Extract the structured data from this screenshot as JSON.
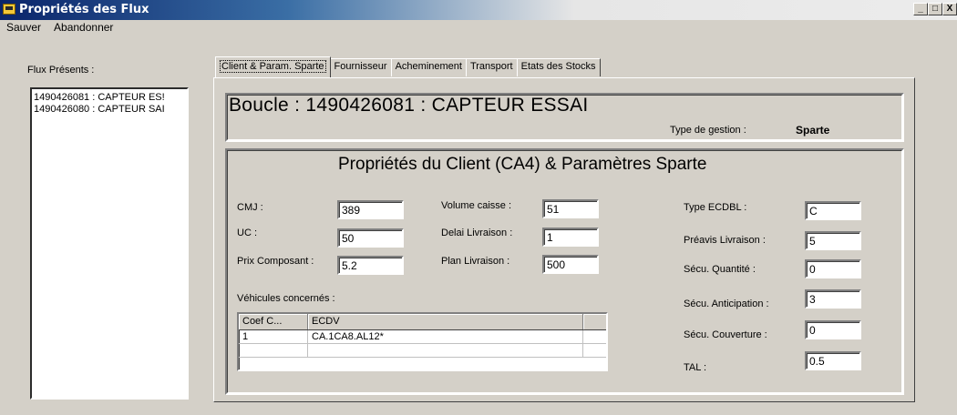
{
  "window": {
    "title": "Propriétés des Flux",
    "buttons": [
      "_",
      "□",
      "X"
    ]
  },
  "menu": {
    "items": [
      {
        "label": "Sauver"
      },
      {
        "label": "Abandonner"
      }
    ]
  },
  "flux": {
    "label": "Flux Présents :",
    "items": [
      "1490426081 : CAPTEUR ES!",
      "1490426080 : CAPTEUR SAI"
    ]
  },
  "tabs": [
    {
      "label": "Client & Param. Sparte",
      "active": true
    },
    {
      "label": "Fournisseur"
    },
    {
      "label": "Acheminement"
    },
    {
      "label": "Transport"
    },
    {
      "label": "Etats des Stocks"
    }
  ],
  "boucle": {
    "title": "Boucle :  1490426081 : CAPTEUR ESSAI",
    "type_gestion_label": "Type de gestion :",
    "type_gestion_value": "Sparte"
  },
  "client": {
    "title": "Propriétés du Client (CA4) & Paramètres Sparte",
    "cmj_label": "CMJ :",
    "cmj": "389",
    "uc_label": "UC :",
    "uc": "50",
    "prix_label": "Prix Composant :",
    "prix": "5.2",
    "volume_label": "Volume caisse :",
    "volume": "51",
    "delai_label": "Delai Livraison :",
    "delai": "1",
    "plan_label": "Plan Livraison :",
    "plan": "500",
    "type_ecdbl_label": "Type ECDBL :",
    "type_ecdbl": "C",
    "preavis_label": "Préavis Livraison :",
    "preavis": "5",
    "secu_qte_label": "Sécu. Quantité :",
    "secu_qte": "0",
    "secu_antic_label": "Sécu. Anticipation :",
    "secu_antic": "3",
    "secu_couv_label": "Sécu. Couverture :",
    "secu_couv": "0",
    "tal_label": "TAL :",
    "tal": "0.5",
    "vehicules_label": "Véhicules concernés :",
    "grid": {
      "headers": [
        "Coef C...",
        "ECDV",
        ""
      ],
      "rows": [
        [
          "1",
          "CA.1CA8.AL12*",
          ""
        ],
        [
          "",
          "",
          ""
        ]
      ]
    }
  }
}
